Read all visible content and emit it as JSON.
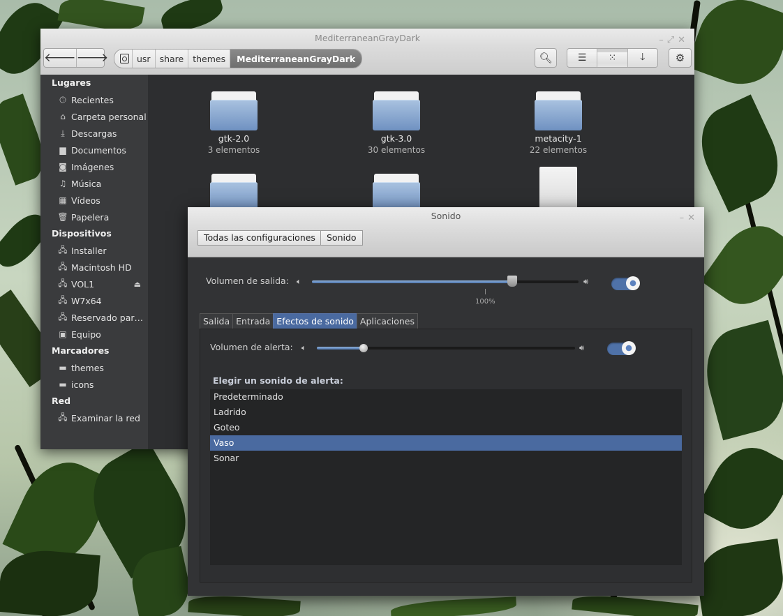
{
  "file_manager": {
    "title": "MediterraneanGrayDark",
    "path": [
      "usr",
      "share",
      "themes",
      "MediterraneanGrayDark"
    ],
    "sidebar": {
      "lugares_heading": "Lugares",
      "lugares": [
        {
          "label": "Recientes",
          "icon": "clock-icon"
        },
        {
          "label": "Carpeta personal",
          "icon": "home-icon"
        },
        {
          "label": "Descargas",
          "icon": "download-icon"
        },
        {
          "label": "Documentos",
          "icon": "document-icon"
        },
        {
          "label": "Imágenes",
          "icon": "camera-icon"
        },
        {
          "label": "Música",
          "icon": "music-icon"
        },
        {
          "label": "Vídeos",
          "icon": "film-icon"
        },
        {
          "label": "Papelera",
          "icon": "trash-icon"
        }
      ],
      "dispositivos_heading": "Dispositivos",
      "dispositivos": [
        {
          "label": "Installer"
        },
        {
          "label": "Macintosh HD"
        },
        {
          "label": "VOL1"
        },
        {
          "label": "W7x64"
        },
        {
          "label": "Reservado par…"
        },
        {
          "label": "Equipo"
        }
      ],
      "marcadores_heading": "Marcadores",
      "marcadores": [
        {
          "label": "themes"
        },
        {
          "label": "icons"
        }
      ],
      "red_heading": "Red",
      "red": [
        {
          "label": "Examinar la red"
        }
      ]
    },
    "items": [
      {
        "name": "gtk-2.0",
        "count": "3 elementos"
      },
      {
        "name": "gtk-3.0",
        "count": "30 elementos"
      },
      {
        "name": "metacity-1",
        "count": "22 elementos"
      }
    ]
  },
  "sound": {
    "title": "Sonido",
    "crumbs": [
      "Todas las configuraciones",
      "Sonido"
    ],
    "output_label": "Volumen de salida:",
    "output_level": 0.75,
    "output_mark": "100%",
    "output_enabled": true,
    "tabs": [
      "Salida",
      "Entrada",
      "Efectos de sonido",
      "Aplicaciones"
    ],
    "active_tab": "Efectos de sonido",
    "alert_label": "Volumen de alerta:",
    "alert_level": 0.18,
    "alert_enabled": true,
    "choose_heading": "Elegir un sonido de alerta:",
    "alert_sounds": [
      "Predeterminado",
      "Ladrido",
      "Goteo",
      "Vaso",
      "Sonar"
    ],
    "selected_sound": "Vaso"
  },
  "colors": {
    "accent": "#4a6aa0",
    "panel_dark": "#2e2f31",
    "titlebar": "#e4e4e4"
  }
}
